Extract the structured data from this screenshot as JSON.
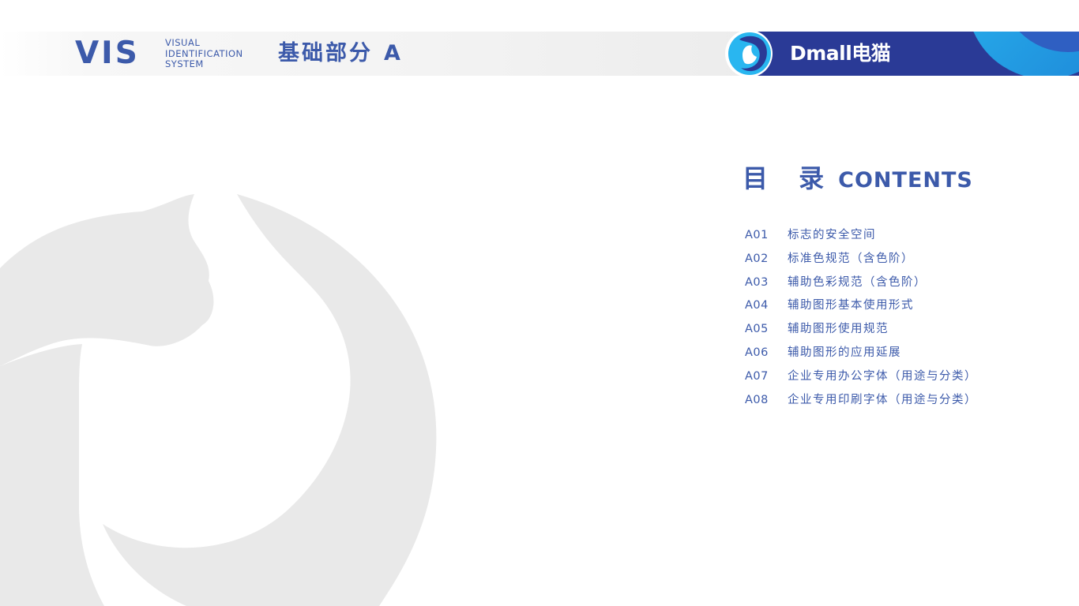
{
  "header": {
    "mark": "VIS",
    "subtitle_lines": [
      "VISUAL",
      "IDENTIFICATION",
      "SYSTEM"
    ],
    "section_title": "基础部分",
    "section_letter": "A",
    "brand_wordmark": "Dmall电猫"
  },
  "contents": {
    "heading_zh": "目 录",
    "heading_en": "CONTENTS",
    "items": [
      {
        "code": "A01",
        "label": "标志的安全空间"
      },
      {
        "code": "A02",
        "label": "标准色规范（含色阶）"
      },
      {
        "code": "A03",
        "label": "辅助色彩规范（含色阶）"
      },
      {
        "code": "A04",
        "label": "辅助图形基本使用形式"
      },
      {
        "code": "A05",
        "label": "辅助图形使用规范"
      },
      {
        "code": "A06",
        "label": "辅助图形的应用延展"
      },
      {
        "code": "A07",
        "label": "企业专用办公字体（用途与分类）"
      },
      {
        "code": "A08",
        "label": "企业专用印刷字体（用途与分类）"
      }
    ]
  },
  "colors": {
    "brand_blue": "#3c5aaa",
    "brand_navy": "#2a3a96",
    "accent_cyan": "#29b6f0",
    "watermark_gray": "#e9e9e9"
  },
  "icons": {
    "logo": "dmall-cat-logo-icon",
    "watermark": "cat-logo-watermark-icon"
  }
}
